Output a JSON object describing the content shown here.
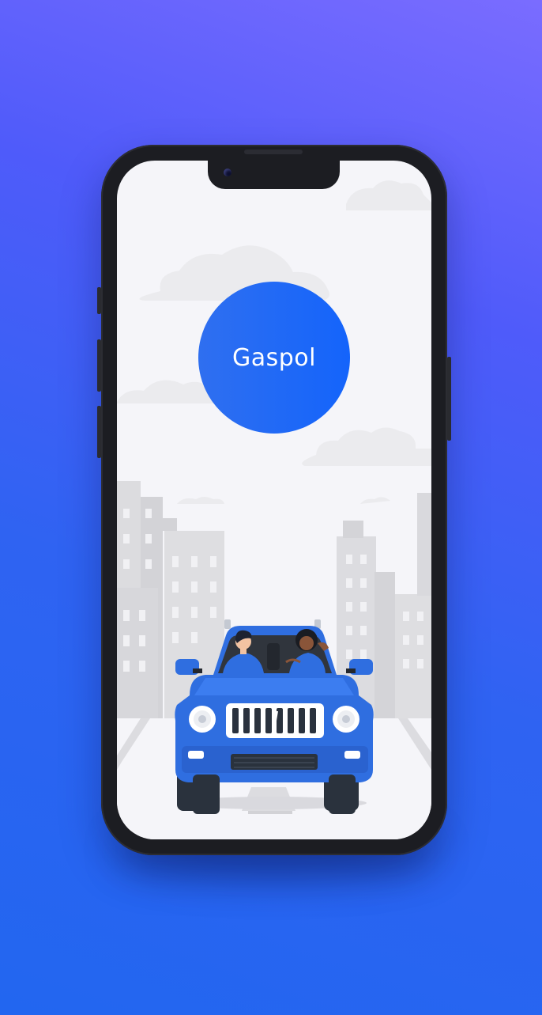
{
  "app": {
    "name": "Gaspol"
  },
  "colors": {
    "background_top": "#7a6cff",
    "background_bottom": "#2266f0",
    "brand": "#1464fb",
    "car_body": "#2f6ee0",
    "screen_background": "#f5f5f9"
  },
  "icons": {
    "illustration": "car-with-driver-and-passenger-illustration"
  }
}
